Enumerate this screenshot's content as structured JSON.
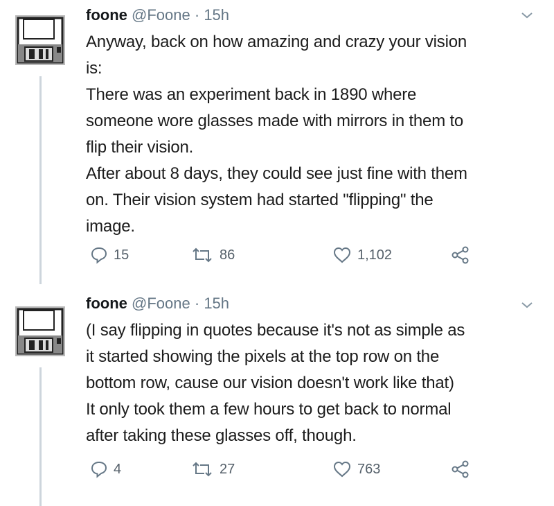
{
  "tweets": [
    {
      "name": "foone",
      "handle": "@Foone",
      "dot": "·",
      "time": "15h",
      "lines": [
        "Anyway, back on how amazing and crazy your vision",
        "is:",
        "There was an experiment back in 1890 where",
        "someone wore glasses made with mirrors in them to",
        "flip their vision.",
        "After about 8 days, they could see just fine with them",
        "on. Their vision system had started \"flipping\" the",
        "image."
      ],
      "replies": "15",
      "retweets": "86",
      "likes": "1,102"
    },
    {
      "name": "foone",
      "handle": "@Foone",
      "dot": "·",
      "time": "15h",
      "lines": [
        "(I say flipping in quotes because it's not as simple as",
        "it started showing the pixels at the top row on the",
        "bottom row, cause our vision doesn't work like that)",
        "It only took them a few hours to get back to normal",
        "after taking these glasses off, though."
      ],
      "replies": "4",
      "retweets": "27",
      "likes": "763"
    }
  ],
  "icons": {
    "avatar": "floppy-disk-icon",
    "menu": "chevron-down-icon",
    "reply": "reply-icon",
    "retweet": "retweet-icon",
    "like": "heart-icon",
    "share": "share-icon"
  },
  "colors": {
    "icon": "#657786",
    "thread_line": "#cdd5dc",
    "name": "#14171a",
    "meta": "#657786"
  }
}
